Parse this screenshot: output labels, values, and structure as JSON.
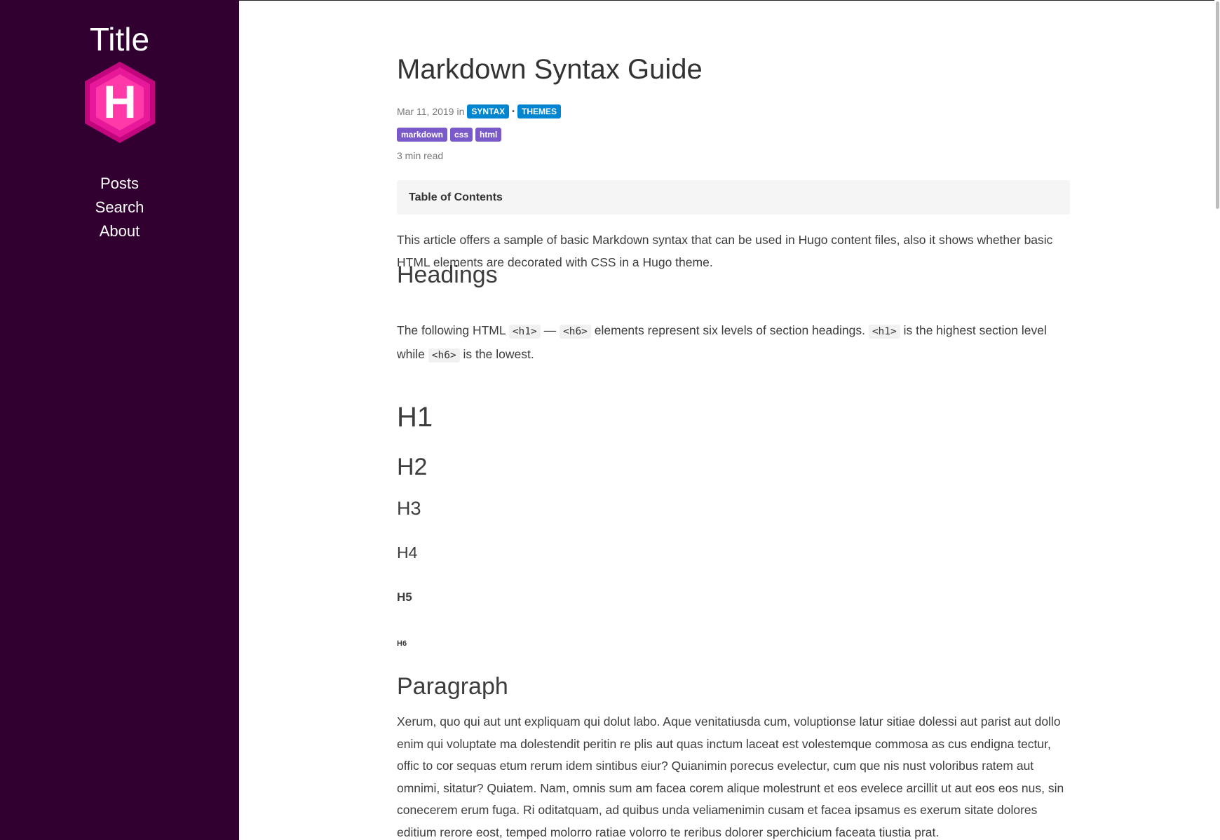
{
  "sidebar": {
    "title": "Title",
    "logo_letter": "H",
    "nav": [
      {
        "label": "Posts"
      },
      {
        "label": "Search"
      },
      {
        "label": "About"
      }
    ]
  },
  "post": {
    "title": "Markdown Syntax Guide",
    "date": "Mar 11, 2019",
    "in_word": "in",
    "categories": [
      "SYNTAX",
      "THEMES"
    ],
    "category_separator": "•",
    "tags": [
      "markdown",
      "css",
      "html"
    ],
    "reading_time": "3 min read",
    "toc_label": "Table of Contents",
    "intro": "This article offers a sample of basic Markdown syntax that can be used in Hugo content files, also it shows whether basic HTML elements are decorated with CSS in a Hugo theme.",
    "headings_section": {
      "title": "Headings",
      "text_1": "The following HTML ",
      "code_h1": "<h1>",
      "dash": " — ",
      "code_h6": "<h6>",
      "text_2": " elements represent six levels of section headings. ",
      "code_h1b": "<h1>",
      "text_3": " is the highest section level while ",
      "code_h6b": "<h6>",
      "text_4": " is the lowest."
    },
    "demo_headings": [
      "H1",
      "H2",
      "H3",
      "H4",
      "H5",
      "H6"
    ],
    "paragraph_section": {
      "title": "Paragraph",
      "text": "Xerum, quo qui aut unt expliquam qui dolut labo. Aque venitatiusda cum, voluptionse latur sitiae dolessi aut parist aut dollo enim qui voluptate ma dolestendit peritin re plis aut quas inctum laceat est volestemque commosa as cus endigna tectur, offic to cor sequas etum rerum idem sintibus eiur? Quianimin porecus evelectur, cum que nis nust voloribus ratem aut omnimi, sitatur? Quiatem. Nam, omnis sum am facea corem alique molestrunt et eos evelece arcillit ut aut eos eos nus, sin conecerem erum fuga. Ri oditatquam, ad quibus unda veliamenimin cusam et facea ipsamus es exerum sitate dolores editium rerore eost, temped molorro ratiae volorro te reribus dolorer sperchicium faceata tiustia prat."
    }
  },
  "colors": {
    "sidebar_bg": "#310030",
    "category_badge": "#0085d1",
    "tag_badge": "#7a5ac8",
    "logo_outer": "#e8189a",
    "logo_inner": "#ff3aa8"
  }
}
